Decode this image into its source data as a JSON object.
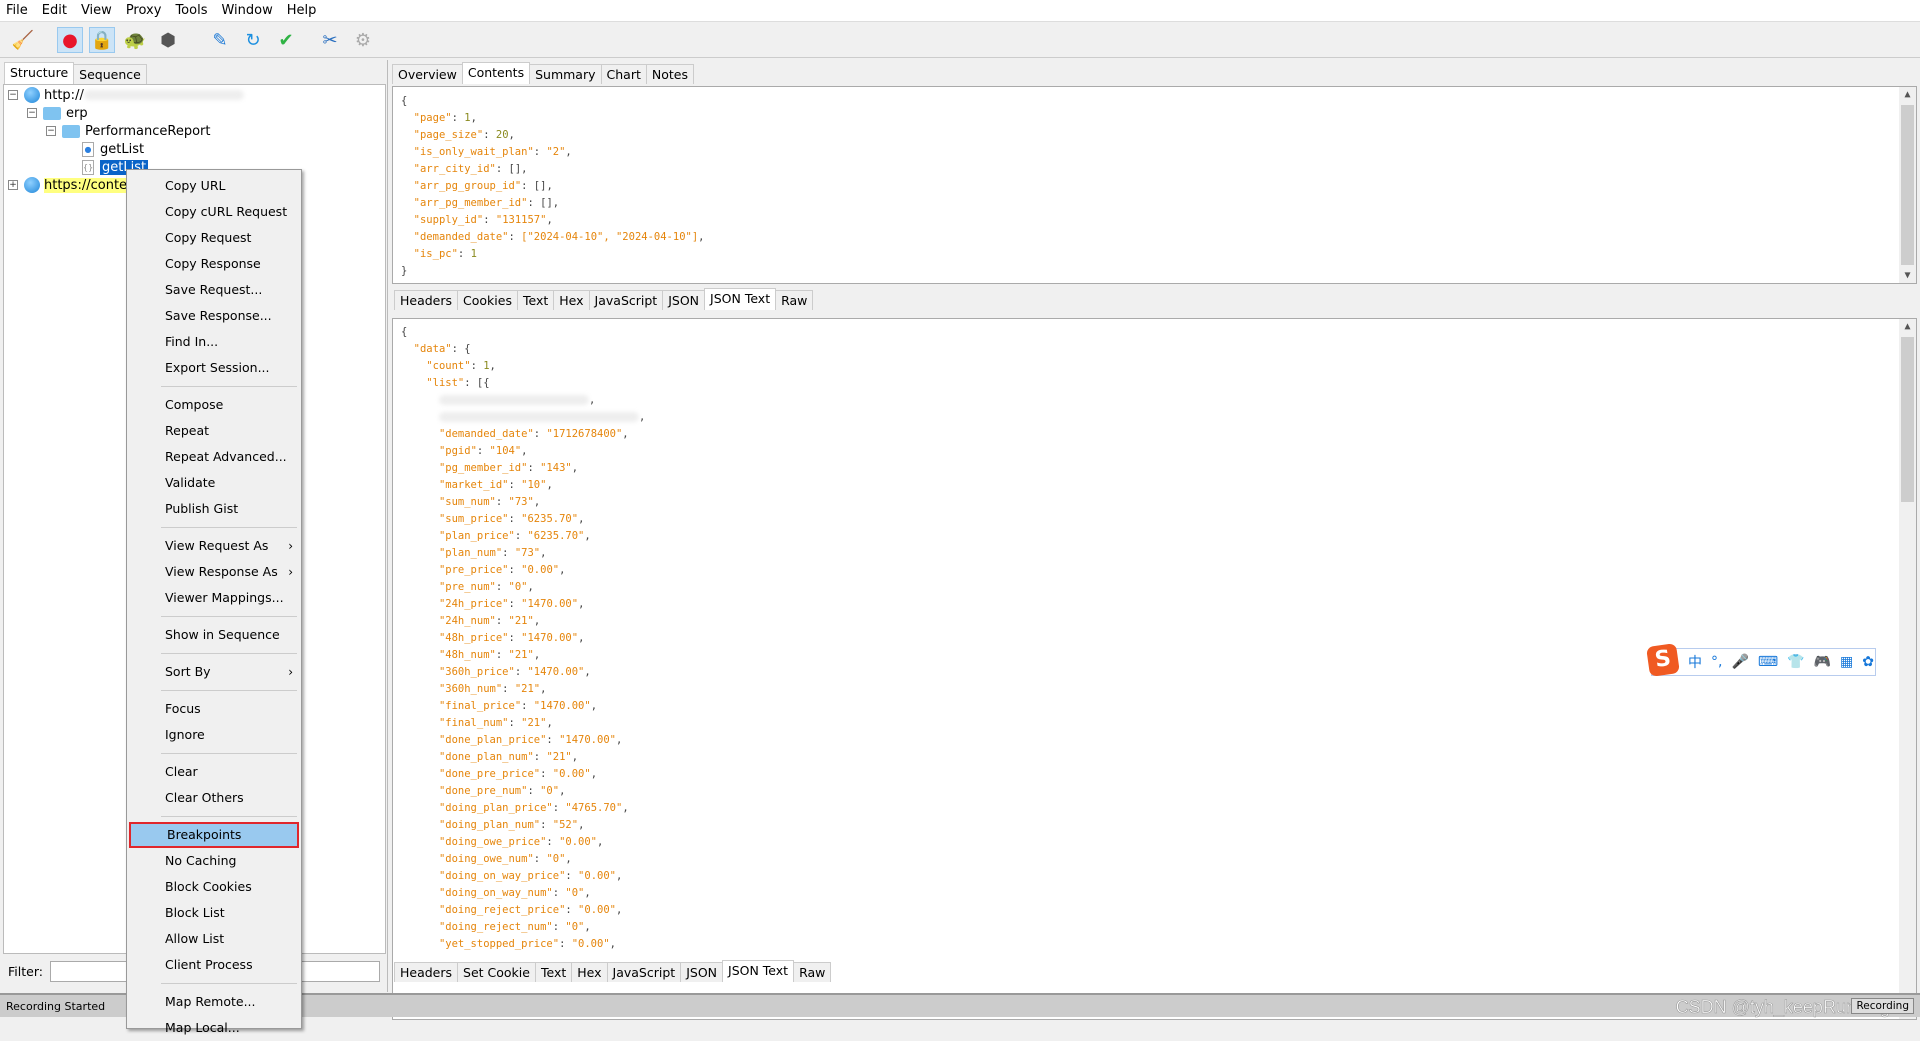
{
  "menubar": [
    "File",
    "Edit",
    "View",
    "Proxy",
    "Tools",
    "Window",
    "Help"
  ],
  "toolbar": [
    {
      "icon": "broom-icon",
      "glyph": "🧹",
      "active": false
    },
    {
      "icon": "record-icon",
      "glyph": "●",
      "active": true,
      "color": "#e8162c"
    },
    {
      "icon": "ssl-lock-icon",
      "glyph": "🔒",
      "active": true
    },
    {
      "icon": "turtle-throttle-icon",
      "glyph": "🐢",
      "active": false
    },
    {
      "icon": "stop-hexagon-icon",
      "glyph": "⬢",
      "active": false,
      "color": "#555555"
    },
    {
      "icon": "compose-pen-icon",
      "glyph": "✎",
      "active": false,
      "color": "#1e7ad6"
    },
    {
      "icon": "repeat-refresh-icon",
      "glyph": "↻",
      "active": false,
      "color": "#1e90e0"
    },
    {
      "icon": "validate-check-icon",
      "glyph": "✔",
      "active": false,
      "color": "#2fb344"
    },
    {
      "icon": "tools-icon",
      "glyph": "✂",
      "active": false,
      "color": "#2a6fbf"
    },
    {
      "icon": "settings-gear-icon",
      "glyph": "⚙",
      "active": false,
      "color": "#aaaaaa"
    }
  ],
  "left": {
    "tabs": [
      "Structure",
      "Sequence"
    ],
    "tree": {
      "host1": "http://",
      "folder1": "erp",
      "folder2": "PerformanceReport",
      "item1": "getList",
      "item2": "getList",
      "host2": "https://content"
    },
    "filter_label": "Filter:",
    "filter_value": ""
  },
  "context_menu": [
    {
      "label": "Copy URL"
    },
    {
      "label": "Copy cURL Request"
    },
    {
      "label": "Copy Request"
    },
    {
      "label": "Copy Response"
    },
    {
      "label": "Save Request..."
    },
    {
      "label": "Save Response..."
    },
    {
      "label": "Find In..."
    },
    {
      "label": "Export Session..."
    },
    {
      "sep": true
    },
    {
      "label": "Compose"
    },
    {
      "label": "Repeat"
    },
    {
      "label": "Repeat Advanced..."
    },
    {
      "label": "Validate"
    },
    {
      "label": "Publish Gist"
    },
    {
      "sep": true
    },
    {
      "label": "View Request As",
      "submenu": true
    },
    {
      "label": "View Response As",
      "submenu": true
    },
    {
      "label": "Viewer Mappings..."
    },
    {
      "sep": true
    },
    {
      "label": "Show in Sequence"
    },
    {
      "sep": true
    },
    {
      "label": "Sort By",
      "submenu": true
    },
    {
      "sep": true
    },
    {
      "label": "Focus"
    },
    {
      "label": "Ignore"
    },
    {
      "sep": true
    },
    {
      "label": "Clear"
    },
    {
      "label": "Clear Others"
    },
    {
      "sep": true
    },
    {
      "label": "Breakpoints",
      "highlighted": true
    },
    {
      "label": "No Caching"
    },
    {
      "label": "Block Cookies"
    },
    {
      "label": "Block List"
    },
    {
      "label": "Allow List"
    },
    {
      "label": "Client Process"
    },
    {
      "sep": true
    },
    {
      "label": "Map Remote..."
    },
    {
      "label": "Map Local..."
    }
  ],
  "right": {
    "tabs": [
      "Overview",
      "Contents",
      "Summary",
      "Chart",
      "Notes"
    ],
    "selected_tab": "Contents",
    "request_tabs": [
      "Headers",
      "Cookies",
      "Text",
      "Hex",
      "JavaScript",
      "JSON",
      "JSON Text",
      "Raw"
    ],
    "response_tabs": [
      "Headers",
      "Set Cookie",
      "Text",
      "Hex",
      "JavaScript",
      "JSON",
      "JSON Text",
      "Raw"
    ],
    "selected_sub_tab": "JSON Text",
    "request_json": [
      {
        "i": 0,
        "raw": "{"
      },
      {
        "i": 1,
        "k": "page",
        "v": "1",
        "t": "n",
        "tail": ","
      },
      {
        "i": 1,
        "k": "page_size",
        "v": "20",
        "t": "n",
        "tail": ","
      },
      {
        "i": 1,
        "k": "is_only_wait_plan",
        "v": "\"2\"",
        "t": "s",
        "tail": ","
      },
      {
        "i": 1,
        "k": "arr_city_id",
        "v": "[]",
        "t": "p",
        "tail": ","
      },
      {
        "i": 1,
        "k": "arr_pg_group_id",
        "v": "[]",
        "t": "p",
        "tail": ","
      },
      {
        "i": 1,
        "k": "arr_pg_member_id",
        "v": "[]",
        "t": "p",
        "tail": ","
      },
      {
        "i": 1,
        "k": "supply_id",
        "v": "\"131157\"",
        "t": "s",
        "tail": ","
      },
      {
        "i": 1,
        "k": "demanded_date",
        "v": "[\"2024-04-10\", \"2024-04-10\"]",
        "t": "s",
        "tail": ","
      },
      {
        "i": 1,
        "k": "is_pc",
        "v": "1",
        "t": "n",
        "tail": ""
      },
      {
        "i": 0,
        "raw": "}"
      }
    ],
    "response_json": [
      {
        "i": 0,
        "raw": "{"
      },
      {
        "i": 1,
        "k": "data",
        "v": "{",
        "t": "p",
        "tail": ""
      },
      {
        "i": 2,
        "k": "count",
        "v": "1",
        "t": "n",
        "tail": ","
      },
      {
        "i": 2,
        "k": "list",
        "v": "[{",
        "t": "p",
        "tail": ""
      },
      {
        "i": 3,
        "blur": 150,
        "tail": ","
      },
      {
        "i": 3,
        "blur": 200,
        "tail": ","
      },
      {
        "i": 3,
        "k": "demanded_date",
        "v": "\"1712678400\"",
        "t": "s",
        "tail": ","
      },
      {
        "i": 3,
        "k": "pgid",
        "v": "\"104\"",
        "t": "s",
        "tail": ","
      },
      {
        "i": 3,
        "k": "pg_member_id",
        "v": "\"143\"",
        "t": "s",
        "tail": ","
      },
      {
        "i": 3,
        "k": "market_id",
        "v": "\"10\"",
        "t": "s",
        "tail": ","
      },
      {
        "i": 3,
        "k": "sum_num",
        "v": "\"73\"",
        "t": "s",
        "tail": ","
      },
      {
        "i": 3,
        "k": "sum_price",
        "v": "\"6235.70\"",
        "t": "s",
        "tail": ","
      },
      {
        "i": 3,
        "k": "plan_price",
        "v": "\"6235.70\"",
        "t": "s",
        "tail": ","
      },
      {
        "i": 3,
        "k": "plan_num",
        "v": "\"73\"",
        "t": "s",
        "tail": ","
      },
      {
        "i": 3,
        "k": "pre_price",
        "v": "\"0.00\"",
        "t": "s",
        "tail": ","
      },
      {
        "i": 3,
        "k": "pre_num",
        "v": "\"0\"",
        "t": "s",
        "tail": ","
      },
      {
        "i": 3,
        "k": "24h_price",
        "v": "\"1470.00\"",
        "t": "s",
        "tail": ","
      },
      {
        "i": 3,
        "k": "24h_num",
        "v": "\"21\"",
        "t": "s",
        "tail": ","
      },
      {
        "i": 3,
        "k": "48h_price",
        "v": "\"1470.00\"",
        "t": "s",
        "tail": ","
      },
      {
        "i": 3,
        "k": "48h_num",
        "v": "\"21\"",
        "t": "s",
        "tail": ","
      },
      {
        "i": 3,
        "k": "360h_price",
        "v": "\"1470.00\"",
        "t": "s",
        "tail": ","
      },
      {
        "i": 3,
        "k": "360h_num",
        "v": "\"21\"",
        "t": "s",
        "tail": ","
      },
      {
        "i": 3,
        "k": "final_price",
        "v": "\"1470.00\"",
        "t": "s",
        "tail": ","
      },
      {
        "i": 3,
        "k": "final_num",
        "v": "\"21\"",
        "t": "s",
        "tail": ","
      },
      {
        "i": 3,
        "k": "done_plan_price",
        "v": "\"1470.00\"",
        "t": "s",
        "tail": ","
      },
      {
        "i": 3,
        "k": "done_plan_num",
        "v": "\"21\"",
        "t": "s",
        "tail": ","
      },
      {
        "i": 3,
        "k": "done_pre_price",
        "v": "\"0.00\"",
        "t": "s",
        "tail": ","
      },
      {
        "i": 3,
        "k": "done_pre_num",
        "v": "\"0\"",
        "t": "s",
        "tail": ","
      },
      {
        "i": 3,
        "k": "doing_plan_price",
        "v": "\"4765.70\"",
        "t": "s",
        "tail": ","
      },
      {
        "i": 3,
        "k": "doing_plan_num",
        "v": "\"52\"",
        "t": "s",
        "tail": ","
      },
      {
        "i": 3,
        "k": "doing_owe_price",
        "v": "\"0.00\"",
        "t": "s",
        "tail": ","
      },
      {
        "i": 3,
        "k": "doing_owe_num",
        "v": "\"0\"",
        "t": "s",
        "tail": ","
      },
      {
        "i": 3,
        "k": "doing_on_way_price",
        "v": "\"0.00\"",
        "t": "s",
        "tail": ","
      },
      {
        "i": 3,
        "k": "doing_on_way_num",
        "v": "\"0\"",
        "t": "s",
        "tail": ","
      },
      {
        "i": 3,
        "k": "doing_reject_price",
        "v": "\"0.00\"",
        "t": "s",
        "tail": ","
      },
      {
        "i": 3,
        "k": "doing_reject_num",
        "v": "\"0\"",
        "t": "s",
        "tail": ","
      },
      {
        "i": 3,
        "k": "yet_stopped_price",
        "v": "\"0.00\"",
        "t": "s",
        "tail": ","
      }
    ]
  },
  "ime": {
    "logo": "S",
    "mode": "中",
    "punct": "°,",
    "icons": [
      "microphone-icon",
      "keyboard-icon",
      "skin-shirt-icon",
      "gamepad-icon",
      "apps-grid-icon",
      "settings-icon"
    ],
    "glyphs": [
      "🎤",
      "⌨",
      "👕",
      "🎮",
      "▦",
      "✿"
    ]
  },
  "status": {
    "text": "Recording Started",
    "recording": "Recording",
    "watermark": "CSDN @tyh_keepRunning"
  }
}
